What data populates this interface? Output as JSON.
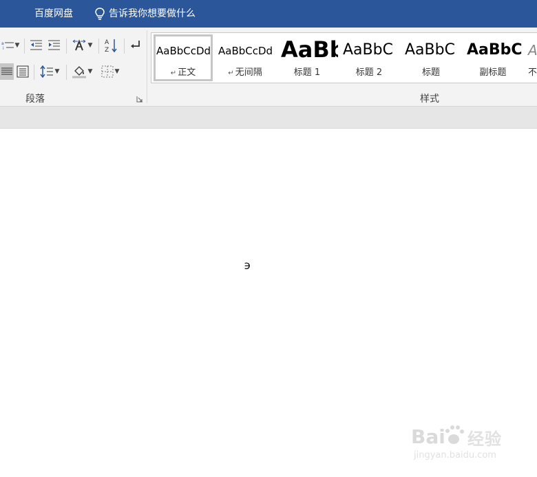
{
  "titlebar": {
    "baidu_netdisk": "百度网盘",
    "tell_me": "告诉我你想要做什么",
    "bg_color": "#2b579a"
  },
  "ribbon": {
    "paragraph_group": {
      "label": "段落",
      "icons": [
        "multilevel-list-icon",
        "decrease-indent-icon",
        "increase-indent-icon",
        "asian-layout-icon",
        "sort-icon",
        "show-marks-icon",
        "justify-icon",
        "distributed-icon",
        "line-spacing-icon",
        "shading-icon",
        "borders-icon",
        "dialog-launcher-icon"
      ]
    },
    "styles_group": {
      "label": "样式",
      "styles": [
        {
          "preview": "AaBbCcDd",
          "name": "正文",
          "para_mark": "↵",
          "selected": true
        },
        {
          "preview": "AaBbCcDd",
          "name": "无间隔",
          "para_mark": "↵",
          "selected": false
        },
        {
          "preview": "AaBb",
          "name": "标题 1",
          "para_mark": "",
          "selected": false
        },
        {
          "preview": "AaBbC",
          "name": "标题 2",
          "para_mark": "",
          "selected": false
        },
        {
          "preview": "AaBbC",
          "name": "标题",
          "para_mark": "",
          "selected": false
        },
        {
          "preview": "AaBbC",
          "name": "副标题",
          "para_mark": "",
          "selected": false
        },
        {
          "preview": "A",
          "name": "不",
          "para_mark": "",
          "selected": false
        }
      ]
    }
  },
  "document": {
    "content": "϶"
  },
  "watermark": {
    "brand": "Bai经验",
    "url": "jingyan.baidu.com"
  }
}
